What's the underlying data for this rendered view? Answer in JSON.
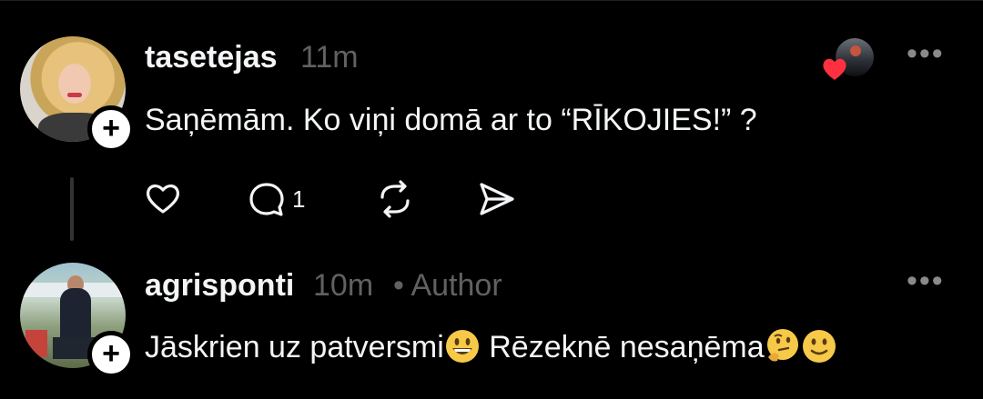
{
  "posts": [
    {
      "username": "tasetejas",
      "time": "11m",
      "text": "Saņēmām. Ko viņi domā ar to “RĪKOJIES!” ?",
      "reply_count": "1",
      "more_label": "•••"
    },
    {
      "username": "agrisponti",
      "time": "10m",
      "author_label": "• Author",
      "text_part1": "Jāskrien uz patversmi",
      "text_part2": " Rēzeknē nesaņēma",
      "more_label": "•••"
    }
  ],
  "icons": {
    "follow": "+",
    "like": "heart-icon",
    "reply": "comment-icon",
    "repost": "repost-icon",
    "share": "send-icon"
  },
  "colors": {
    "background": "#000000",
    "text": "#f3f5f7",
    "secondary": "#616161",
    "heart": "#ff3040"
  }
}
